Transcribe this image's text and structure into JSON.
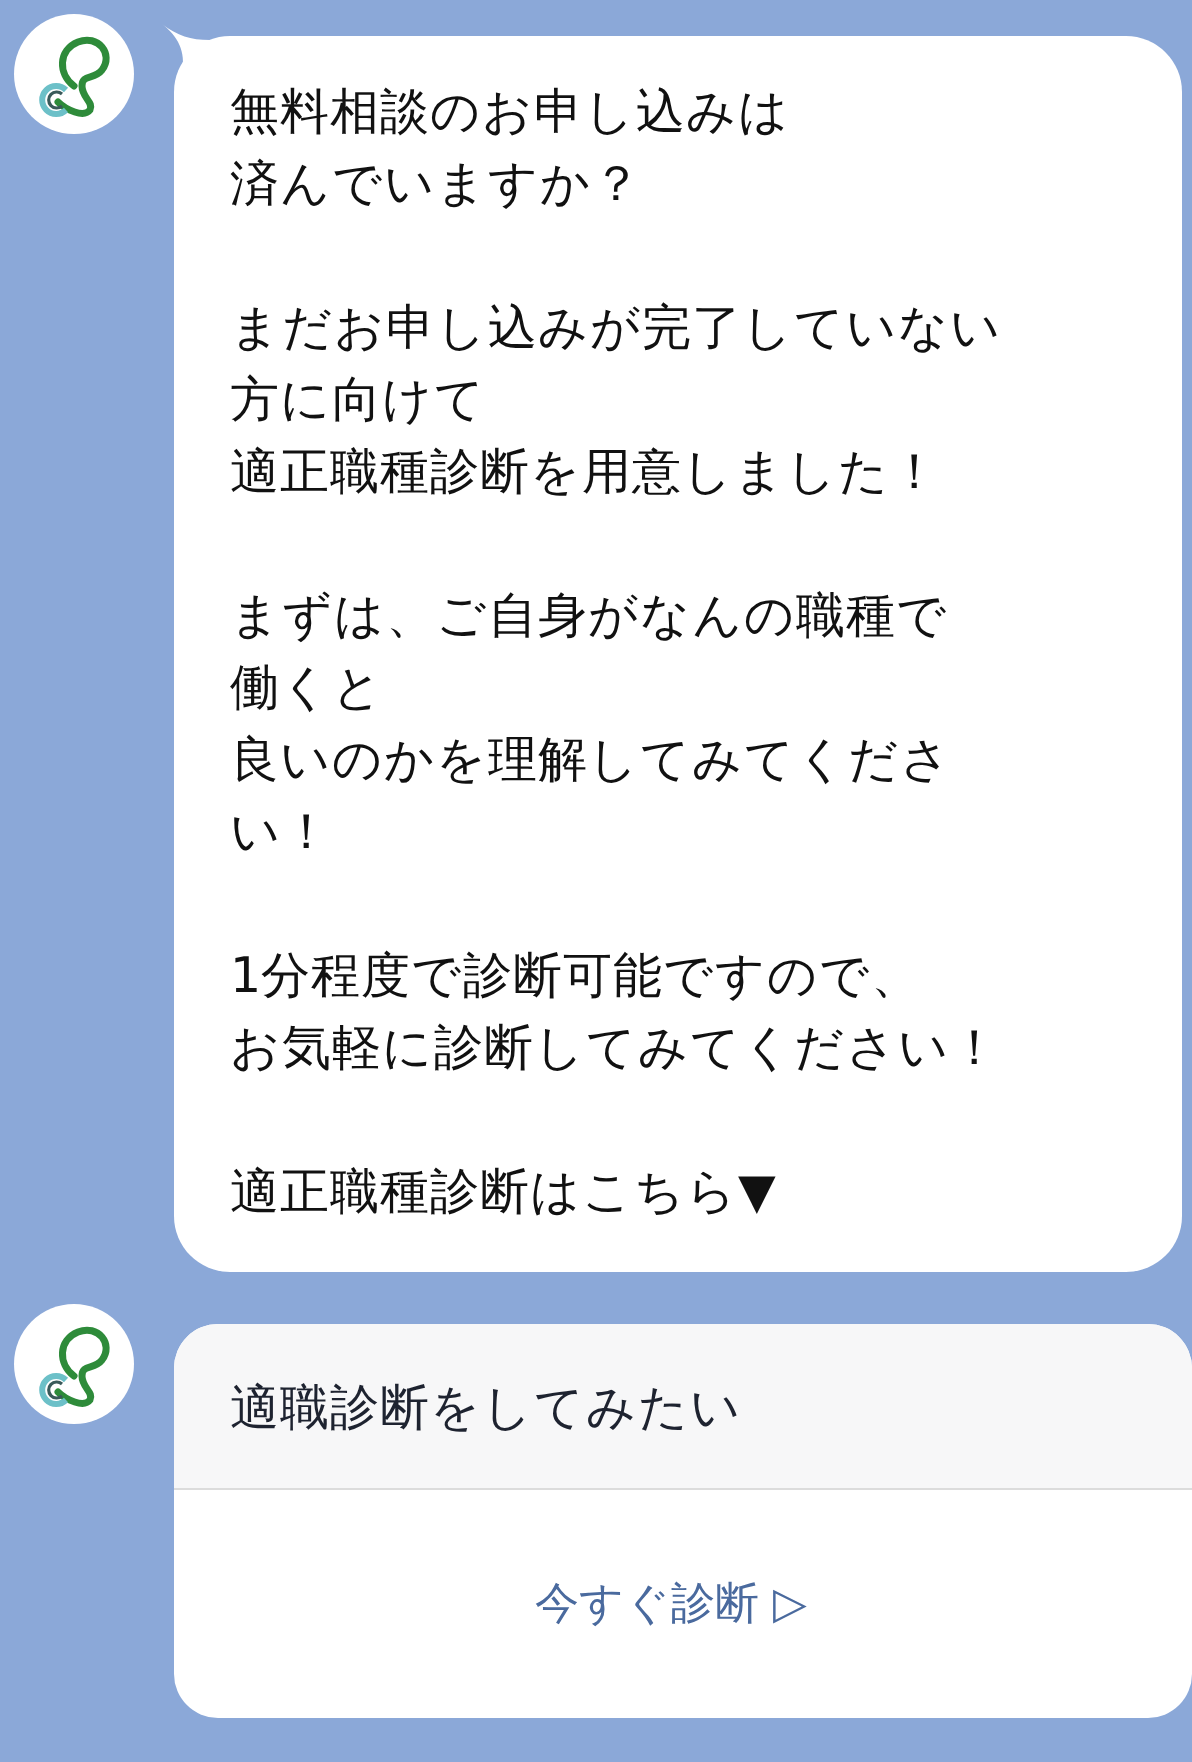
{
  "messages": [
    {
      "kind": "text",
      "paragraphs": [
        {
          "lines": [
            "無料相談のお申し込みは",
            "済んでいますか？"
          ]
        },
        {
          "lines": [
            "まだお申し込みが完了していない",
            "方に向けて",
            "適正職種診断を用意しました！"
          ]
        },
        {
          "lines": [
            "まずは、ご自身がなんの職種で",
            "働くと",
            "良いのかを理解してみてくださ",
            "い！"
          ]
        },
        {
          "lines": [
            "1分程度で診断可能ですので、",
            "お気軽に診断してみてください！"
          ]
        },
        {
          "lines": [
            "適正職種診断はこちら▼"
          ]
        }
      ]
    },
    {
      "kind": "card",
      "title": "適職診断をしてみたい",
      "action": "今すぐ診断 ▷"
    }
  ]
}
